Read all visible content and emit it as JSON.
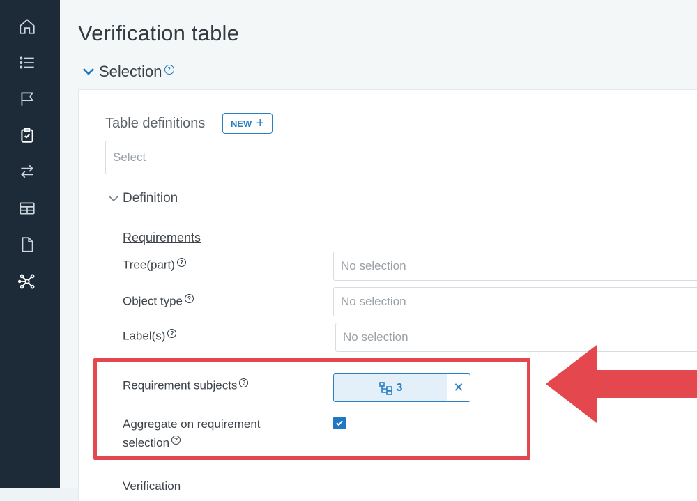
{
  "sidebar": {
    "items": [
      {
        "icon": "home-icon"
      },
      {
        "icon": "list-icon"
      },
      {
        "icon": "flag-icon"
      },
      {
        "icon": "clipboard-check-icon"
      },
      {
        "icon": "transfer-arrows-icon"
      },
      {
        "icon": "table-icon"
      },
      {
        "icon": "document-icon"
      },
      {
        "icon": "network-icon"
      }
    ]
  },
  "page": {
    "title": "Verification table",
    "section": "Selection"
  },
  "table_definitions": {
    "label": "Table definitions",
    "new_button": "NEW",
    "select_placeholder": "Select"
  },
  "definition": {
    "label": "Definition",
    "requirements_heading": "Requirements",
    "fields": [
      {
        "label": "Tree(part)",
        "placeholder": "No selection"
      },
      {
        "label": "Object type",
        "placeholder": "No selection"
      },
      {
        "label": "Label(s)",
        "placeholder": "No selection"
      }
    ],
    "requirement_subjects": {
      "label": "Requirement subjects",
      "count": "3"
    },
    "aggregate": {
      "label_line1": "Aggregate on requirement",
      "label_line2": "selection",
      "checked": true
    },
    "next_heading": "Verification"
  },
  "annotation": {
    "color": "#e5474f"
  },
  "colors": {
    "sidebar": "#1d2a38",
    "accent": "#2a7fc1"
  }
}
